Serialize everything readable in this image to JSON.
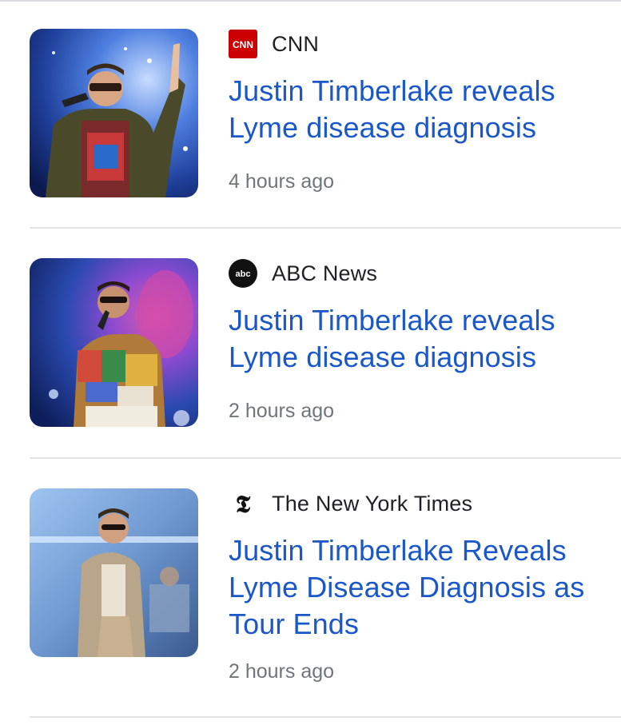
{
  "articles": [
    {
      "source": "CNN",
      "source_logo": "cnn-logo-icon",
      "headline": "Justin Timberlake reveals Lyme disease diagnosis",
      "time": "4 hours ago",
      "thumbnail": "concert-performer-photo"
    },
    {
      "source": "ABC News",
      "source_logo": "abc-news-logo-icon",
      "headline": "Justin Timberlake reveals Lyme disease diagnosis",
      "time": "2 hours ago",
      "thumbnail": "concert-performer-photo"
    },
    {
      "source": "The New York Times",
      "source_logo": "nyt-logo-icon",
      "headline": "Justin Timberlake Reveals Lyme Disease Diagnosis as Tour Ends",
      "time": "2 hours ago",
      "thumbnail": "concert-performer-photo"
    }
  ],
  "colors": {
    "headline": "#1a57c9",
    "source": "#202124",
    "time": "#70757a",
    "divider": "#e3e4e8",
    "cnn_red": "#cc0000"
  }
}
